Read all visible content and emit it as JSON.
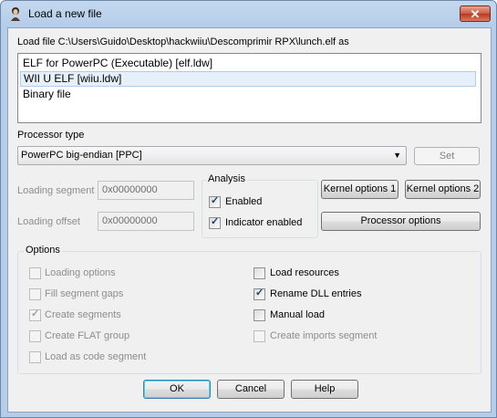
{
  "window": {
    "title": "Load a new file",
    "close_glyph": "✕"
  },
  "load_file_label": "Load file C:\\Users\\Guido\\Desktop\\hackwiiu\\Descomprimir RPX\\lunch.elf as",
  "file_types": [
    "ELF for PowerPC (Executable) [elf.ldw]",
    "WII U ELF [wiiu.ldw]",
    "Binary file"
  ],
  "processor": {
    "label": "Processor type",
    "selected": "PowerPC big-endian [PPC]",
    "set_label": "Set"
  },
  "loading_segment": {
    "label": "Loading segment",
    "value": "0x00000000"
  },
  "loading_offset": {
    "label": "Loading offset",
    "value": "0x00000000"
  },
  "analysis": {
    "title": "Analysis",
    "enabled_label": "Enabled",
    "indicator_label": "Indicator enabled"
  },
  "buttons": {
    "kernel1": "Kernel options 1",
    "kernel2": "Kernel options 2",
    "processor_options": "Processor options",
    "ok": "OK",
    "cancel": "Cancel",
    "help": "Help"
  },
  "options": {
    "title": "Options",
    "left": [
      "Loading options",
      "Fill segment gaps",
      "Create segments",
      "Create FLAT group",
      "Load as code segment"
    ],
    "right": [
      "Load resources",
      "Rename DLL entries",
      "Manual load",
      "Create imports segment"
    ]
  },
  "colors": {
    "selection": "#e5f0fb",
    "titlebar": "#b5cde9",
    "close": "#c95a42"
  }
}
